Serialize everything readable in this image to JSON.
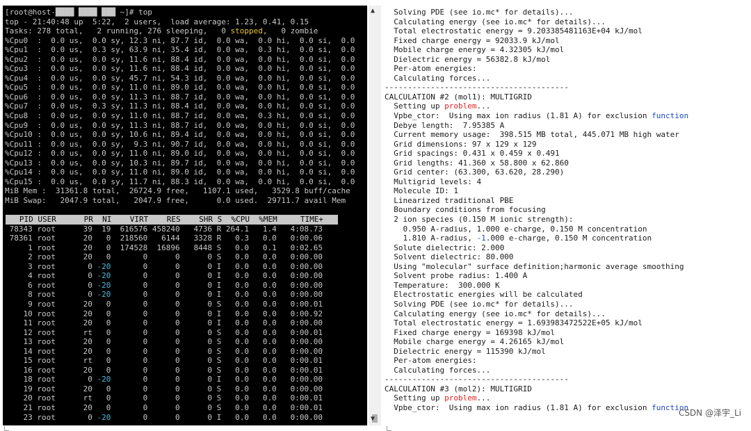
{
  "left_terminal": {
    "lines": [
      [
        {
          "t": "[root@host-"
        },
        {
          "t": "████ ████ ███"
        },
        {
          "t": " ~]# top"
        }
      ],
      [
        {
          "t": "top - 21:40:48 up  5:22,  2 users,  load average: 1.23, 0.41, 0.15"
        }
      ],
      [
        {
          "t": "Tasks: 278 total,   2 running, 276 sleeping,   0 "
        },
        {
          "t": "stopped",
          "c": "y"
        },
        {
          "t": ",   0 zombie"
        }
      ],
      [
        {
          "t": "%Cpu0  :  0.0 us,  0.0 sy, 12.3 ni, 87.7 id,  0.0 wa,  0.0 hi,  0.0 si,  0.0"
        }
      ],
      [
        {
          "t": "%Cpu1  :  0.0 us,  0.3 sy, 63.9 ni, 35.4 id,  0.0 wa,  0.3 hi,  0.0 si,  0.0"
        }
      ],
      [
        {
          "t": "%Cpu2  :  0.0 us,  0.0 sy, 11.6 ni, 88.4 id,  0.0 wa,  0.0 hi,  0.0 si,  0.0"
        }
      ],
      [
        {
          "t": "%Cpu3  :  0.0 us,  0.0 sy, 11.6 ni, 88.4 id,  0.0 wa,  0.0 hi,  0.0 si,  0.0"
        }
      ],
      [
        {
          "t": "%Cpu4  :  0.0 us,  0.0 sy, 45.7 ni, 54.3 id,  0.0 wa,  0.0 hi,  0.0 si,  0.0"
        }
      ],
      [
        {
          "t": "%Cpu5  :  0.0 us,  0.0 sy, 11.0 ni, 89.0 id,  0.0 wa,  0.0 hi,  0.0 si,  0.0"
        }
      ],
      [
        {
          "t": "%Cpu6  :  0.0 us,  0.0 sy, 11.3 ni, 88.7 id,  0.0 wa,  0.0 hi,  0.0 si,  0.0"
        }
      ],
      [
        {
          "t": "%Cpu7  :  0.0 us,  0.3 sy, 11.3 ni, 88.4 id,  0.0 wa,  0.0 hi,  0.0 si,  0.0"
        }
      ],
      [
        {
          "t": "%Cpu8  :  0.0 us,  0.0 sy, 11.0 ni, 88.7 id,  0.0 wa,  0.3 hi,  0.0 si,  0.0"
        }
      ],
      [
        {
          "t": "%Cpu9  :  0.0 us,  0.0 sy, 11.3 ni, 88.7 id,  0.0 wa,  0.0 hi,  0.0 si,  0.0"
        }
      ],
      [
        {
          "t": "%Cpu10 :  0.0 us,  0.0 sy, 10.6 ni, 89.4 id,  0.0 wa,  0.0 hi,  0.0 si,  0.0"
        }
      ],
      [
        {
          "t": "%Cpu11 :  0.0 us,  0.0 sy,  9.3 ni, 90.7 id,  0.0 wa,  0.0 hi,  0.0 si,  0.0"
        }
      ],
      [
        {
          "t": "%Cpu12 :  0.0 us,  0.0 sy, 11.0 ni, 89.0 id,  0.0 wa,  0.0 hi,  0.0 si,  0.0"
        }
      ],
      [
        {
          "t": "%Cpu13 :  0.0 us,  0.0 sy, 10.3 ni, 89.7 id,  0.0 wa,  0.0 hi,  0.0 si,  0.0"
        }
      ],
      [
        {
          "t": "%Cpu14 :  0.0 us,  0.0 sy, 11.0 ni, 89.0 id,  0.0 wa,  0.0 hi,  0.0 si,  0.0"
        }
      ],
      [
        {
          "t": "%Cpu15 :  0.0 us,  0.0 sy, 11.7 ni, 88.3 id,  0.0 wa,  0.0 hi,  0.0 si,  0.0"
        }
      ],
      [
        {
          "t": "MiB Mem :  31361.8 total,  26724.9 free,   1107.1 used,   3529.8 buff/cache"
        }
      ],
      [
        {
          "t": "MiB Swap:   2047.9 total,   2047.9 free,      0.0 used.  29711.7 avail Mem"
        }
      ],
      [
        {
          "t": ""
        }
      ]
    ],
    "table_header": "   PID USER      PR  NI    VIRT    RES    SHR S  %CPU  %MEM     TIME+",
    "processes": [
      [
        {
          "t": " 78343 root      39  19  616576 458240   4736 R 264.1   1.4   4:08.73"
        }
      ],
      [
        {
          "t": " 78361 root      20   0  218560   6144   3328 R   0.3   0.0   0:00.06"
        }
      ],
      [
        {
          "t": "     1 root      20   0  174528  16896   8448 S   0.0   0.1   0:02.65"
        }
      ],
      [
        {
          "t": "     2 root      20   0       0      0      0 S   0.0   0.0   0:00.00"
        }
      ],
      [
        {
          "t": "     3 root       0 "
        },
        {
          "t": "-20",
          "c": "c"
        },
        {
          "t": "       0      0      0 I   0.0   0.0   0:00.00"
        }
      ],
      [
        {
          "t": "     4 root       0 "
        },
        {
          "t": "-20",
          "c": "c"
        },
        {
          "t": "       0      0      0 I   0.0   0.0   0:00.00"
        }
      ],
      [
        {
          "t": "     6 root       0 "
        },
        {
          "t": "-20",
          "c": "c"
        },
        {
          "t": "       0      0      0 I   0.0   0.0   0:00.00"
        }
      ],
      [
        {
          "t": "     8 root       0 "
        },
        {
          "t": "-20",
          "c": "c"
        },
        {
          "t": "       0      0      0 I   0.0   0.0   0:00.00"
        }
      ],
      [
        {
          "t": "     9 root      20   0       0      0      0 S   0.0   0.0   0:00.01"
        }
      ],
      [
        {
          "t": "    10 root      20   0       0      0      0 I   0.0   0.0   0:00.92"
        }
      ],
      [
        {
          "t": "    11 root      20   0       0      0      0 I   0.0   0.0   0:00.00"
        }
      ],
      [
        {
          "t": "    12 root      rt   0       0      0      0 S   0.0   0.0   0:00.01"
        }
      ],
      [
        {
          "t": "    13 root      20   0       0      0      0 S   0.0   0.0   0:00.00"
        }
      ],
      [
        {
          "t": "    14 root      20   0       0      0      0 S   0.0   0.0   0:00.00"
        }
      ],
      [
        {
          "t": "    15 root      rt   0       0      0      0 S   0.0   0.0   0:00.01"
        }
      ],
      [
        {
          "t": "    16 root      20   0       0      0      0 S   0.0   0.0   0:00.01"
        }
      ],
      [
        {
          "t": "    18 root       0 "
        },
        {
          "t": "-20",
          "c": "c"
        },
        {
          "t": "       0      0      0 I   0.0   0.0   0:00.00"
        }
      ],
      [
        {
          "t": "    19 root      20   0       0      0      0 S   0.0   0.0   0:00.00"
        }
      ],
      [
        {
          "t": "    20 root      rt   0       0      0      0 S   0.0   0.0   0:00.01"
        }
      ],
      [
        {
          "t": "    21 root      20   0       0      0      0 S   0.0   0.0   0:00.01"
        }
      ],
      [
        {
          "t": "    23 root       0 "
        },
        {
          "t": "-20",
          "c": "c"
        },
        {
          "t": "       0      0      0 I   0.0   0.0   0:00.00"
        }
      ]
    ]
  },
  "right_terminal": {
    "lines": [
      [
        {
          "t": "  Solving PDE (see io.mc* for details)..."
        }
      ],
      [
        {
          "t": "  Calculating energy (see io.mc* for details)..."
        }
      ],
      [
        {
          "t": "  Total electrostatic energy = 9.203385481163E+04 kJ/mol"
        }
      ],
      [
        {
          "t": "  Fixed charge energy = 92033.9 kJ/mol"
        }
      ],
      [
        {
          "t": "  Mobile charge energy = 4.32305 kJ/mol"
        }
      ],
      [
        {
          "t": "  Dielectric energy = 56382.8 kJ/mol"
        }
      ],
      [
        {
          "t": "  Per-atom energies:"
        }
      ],
      [
        {
          "t": "  Calculating forces..."
        }
      ],
      [
        {
          "t": "----------------------------------------"
        }
      ],
      [
        {
          "t": "CALCULATION #2 (mol1): MULTIGRID"
        }
      ],
      [
        {
          "t": "  Setting up "
        },
        {
          "t": "problem",
          "c": "r"
        },
        {
          "t": "..."
        }
      ],
      [
        {
          "t": "  Vpbe_ctor:  Using max ion radius (1.81 A) for exclusion "
        },
        {
          "t": "function",
          "c": "b"
        }
      ],
      [
        {
          "t": "  Debye length:  7.95385 A"
        }
      ],
      [
        {
          "t": "  Current memory usage:  398.515 MB total, 445.071 MB high water"
        }
      ],
      [
        {
          "t": "  Grid dimensions: 97 x 129 x 129"
        }
      ],
      [
        {
          "t": "  Grid spacings: 0.431 x 0.459 x 0.491"
        }
      ],
      [
        {
          "t": "  Grid lengths: 41.360 x 58.800 x 62.860"
        }
      ],
      [
        {
          "t": "  Grid center: (63.300, 63.620, 28.290)"
        }
      ],
      [
        {
          "t": "  Multigrid levels: 4"
        }
      ],
      [
        {
          "t": "  Molecule ID: 1"
        }
      ],
      [
        {
          "t": "  Linearized traditional PBE"
        }
      ],
      [
        {
          "t": "  Boundary conditions from focusing"
        }
      ],
      [
        {
          "t": "  2 ion species (0.150 M ionic strength):"
        }
      ],
      [
        {
          "t": "    0.950 A-radius, 1.000 e-charge, 0.150 M concentration"
        }
      ],
      [
        {
          "t": "    1.810 A-radius, "
        },
        {
          "t": "-1",
          "c": "b"
        },
        {
          "t": ".000 e-charge, 0.150 M concentration"
        }
      ],
      [
        {
          "t": "  Solute dielectric: 2.000"
        }
      ],
      [
        {
          "t": "  Solvent dielectric: 80.000"
        }
      ],
      [
        {
          "t": "  Using \"molecular\" surface definition;harmonic average smoothing"
        }
      ],
      [
        {
          "t": "  Solvent probe radius: 1.400 A"
        }
      ],
      [
        {
          "t": "  Temperature:  300.000 K"
        }
      ],
      [
        {
          "t": "  Electrostatic energies will be calculated"
        }
      ],
      [
        {
          "t": "  Solving PDE (see io.mc* for details)..."
        }
      ],
      [
        {
          "t": "  Calculating energy (see io.mc* for details)..."
        }
      ],
      [
        {
          "t": "  Total electrostatic energy = 1.693983472522E+05 kJ/mol"
        }
      ],
      [
        {
          "t": "  Fixed charge energy = 169398 kJ/mol"
        }
      ],
      [
        {
          "t": "  Mobile charge energy = 4.26165 kJ/mol"
        }
      ],
      [
        {
          "t": "  Dielectric energy = 115390 kJ/mol"
        }
      ],
      [
        {
          "t": "  Per-atom energies:"
        }
      ],
      [
        {
          "t": "  Calculating forces..."
        }
      ],
      [
        {
          "t": "----------------------------------------"
        }
      ],
      [
        {
          "t": "CALCULATION #3 (mol2): MULTIGRID"
        }
      ],
      [
        {
          "t": "  Setting up "
        },
        {
          "t": "problem",
          "c": "r"
        },
        {
          "t": "..."
        }
      ],
      [
        {
          "t": "  Vpbe_ctor:  Using max ion radius (1.81 A) for exclusion "
        },
        {
          "t": "function",
          "c": "b"
        }
      ]
    ]
  },
  "scrollbar": {
    "up_arrow": "▲",
    "down_arrow": "▼"
  },
  "watermark": "CSDN @泽宇_Li"
}
